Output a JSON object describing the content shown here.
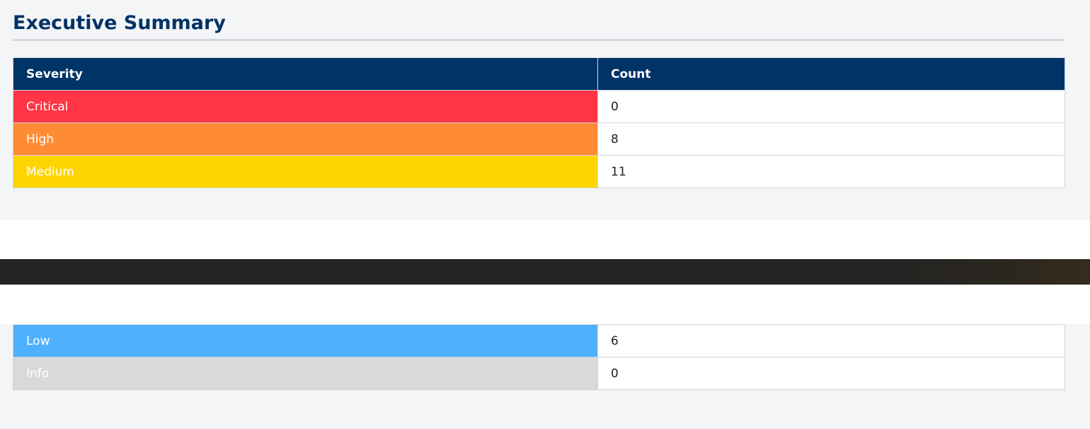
{
  "summary": {
    "title": "Executive Summary",
    "headers": {
      "severity": "Severity",
      "count": "Count"
    },
    "rows": [
      {
        "severity": "Critical",
        "count": "0",
        "color": "#ff3545"
      },
      {
        "severity": "High",
        "count": "8",
        "color": "#ff8c35"
      },
      {
        "severity": "Medium",
        "count": "11",
        "color": "#ffd500"
      },
      {
        "severity": "Low",
        "count": "6",
        "color": "#4eb1ff"
      },
      {
        "severity": "Info",
        "count": "0",
        "color": "#d9d9d9"
      }
    ]
  },
  "colors": {
    "header_bg": "#003366",
    "title": "#003366",
    "page_bg": "#f4f5f7",
    "dark_band": "#242424"
  }
}
